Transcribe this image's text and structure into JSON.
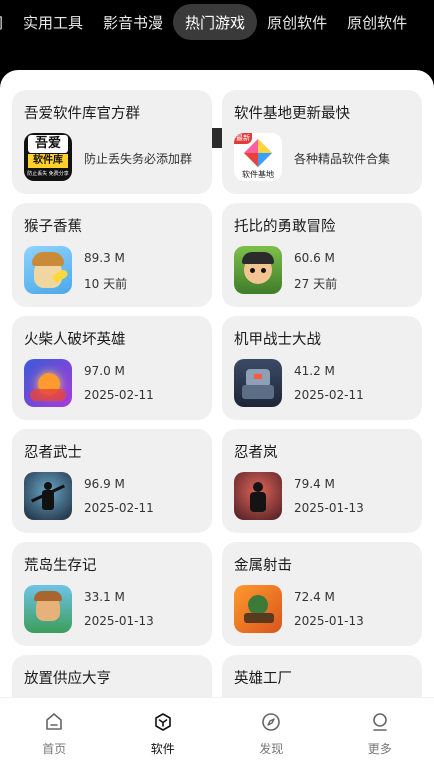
{
  "tabs": [
    {
      "label": "网"
    },
    {
      "label": "实用工具"
    },
    {
      "label": "影音书漫"
    },
    {
      "label": "热门游戏"
    },
    {
      "label": "原创软件"
    },
    {
      "label": "原创软件"
    }
  ],
  "cards": [
    {
      "title": "吾爱软件库官方群",
      "icon": "wuai-logo-icon",
      "desc": "防止丢失务必添加群"
    },
    {
      "title": "软件基地更新最快",
      "icon": "software-base-logo-icon",
      "desc": "各种精品软件合集"
    },
    {
      "title": "猴子香蕉",
      "icon": "monkey-banana-icon",
      "size": "89.3 M",
      "date": "10 天前"
    },
    {
      "title": "托比的勇敢冒险",
      "icon": "toby-adventure-icon",
      "size": "60.6 M",
      "date": "27 天前"
    },
    {
      "title": "火柴人破坏英雄",
      "icon": "stickman-hero-icon",
      "size": "97.0 M",
      "date": "2025-02-11"
    },
    {
      "title": "机甲战士大战",
      "icon": "mech-warrior-icon",
      "size": "41.2 M",
      "date": "2025-02-11"
    },
    {
      "title": "忍者武士",
      "icon": "ninja-samurai-icon",
      "size": "96.9 M",
      "date": "2025-02-11"
    },
    {
      "title": "忍者岚",
      "icon": "ninja-arashi-icon",
      "size": "79.4 M",
      "date": "2025-01-13"
    },
    {
      "title": "荒岛生存记",
      "icon": "island-survival-icon",
      "size": "33.1 M",
      "date": "2025-01-13"
    },
    {
      "title": "金属射击",
      "icon": "metal-shooter-icon",
      "size": "72.4 M",
      "date": "2025-01-13"
    },
    {
      "title": "放置供应大亨",
      "icon": "idle-tycoon-icon"
    },
    {
      "title": "英雄工厂",
      "icon": "hero-factory-icon"
    }
  ],
  "icon_text": {
    "wuai_line1": "吾爱",
    "wuai_line2": "软件库",
    "wuai_line3": "防止丢失 免费分享",
    "base_badge": "最新",
    "base_text": "软件基地"
  },
  "nav": [
    {
      "label": "首页",
      "icon": "home-icon"
    },
    {
      "label": "软件",
      "icon": "box-icon",
      "active": true
    },
    {
      "label": "发现",
      "icon": "compass-icon"
    },
    {
      "label": "更多",
      "icon": "user-icon"
    }
  ]
}
